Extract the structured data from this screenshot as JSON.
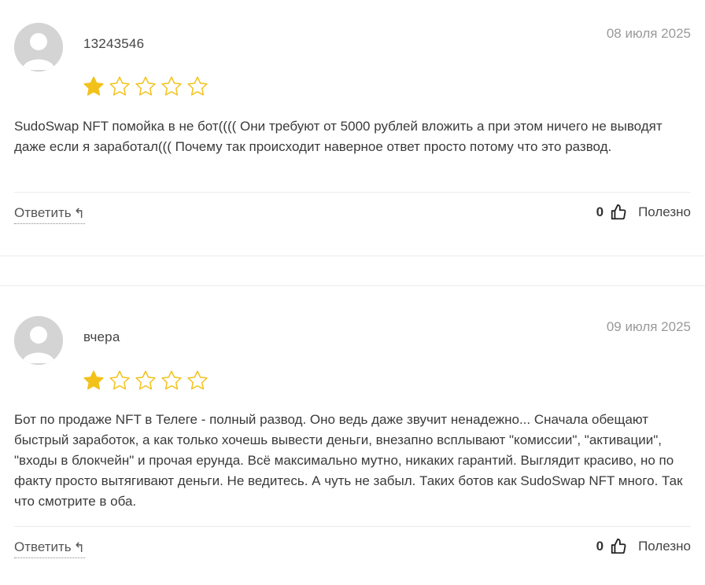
{
  "colors": {
    "star_filled": "#f2c21b",
    "star_empty_stroke": "#f2c21b",
    "date": "#9a9a9a",
    "text": "#3a3a3a"
  },
  "reviews": [
    {
      "author": "13243546",
      "date": "08 июля 2025",
      "rating": 1,
      "max_rating": 5,
      "text": "SudoSwap NFT помойка в не бот(((( Они требуют от 5000 рублей вложить а при этом ничего не выводят даже если я заработал((( Почему так происходит наверное ответ просто потому что это развод.",
      "reply_label": "Ответить",
      "reply_icon": "reply-arrow-icon",
      "useful_count": "0",
      "useful_label": "Полезно"
    },
    {
      "author": "вчера",
      "date": "09 июля 2025",
      "rating": 1,
      "max_rating": 5,
      "text": "Бот по продаже NFT в Телеге - полный развод. Оно ведь даже звучит ненадежно... Сначала обещают быстрый заработок, а как только хочешь вывести деньги, внезапно всплывают \"комиссии\", \"активации\", \"входы в блокчейн\" и прочая ерунда. Всё максимально мутно, никаких гарантий. Выглядит красиво, но по факту просто вытягивают деньги. Не ведитесь. А чуть не забыл. Таких ботов как SudoSwap NFT много. Так что смотрите в оба.",
      "reply_label": "Ответить",
      "reply_icon": "reply-arrow-icon",
      "useful_count": "0",
      "useful_label": "Полезно"
    }
  ]
}
